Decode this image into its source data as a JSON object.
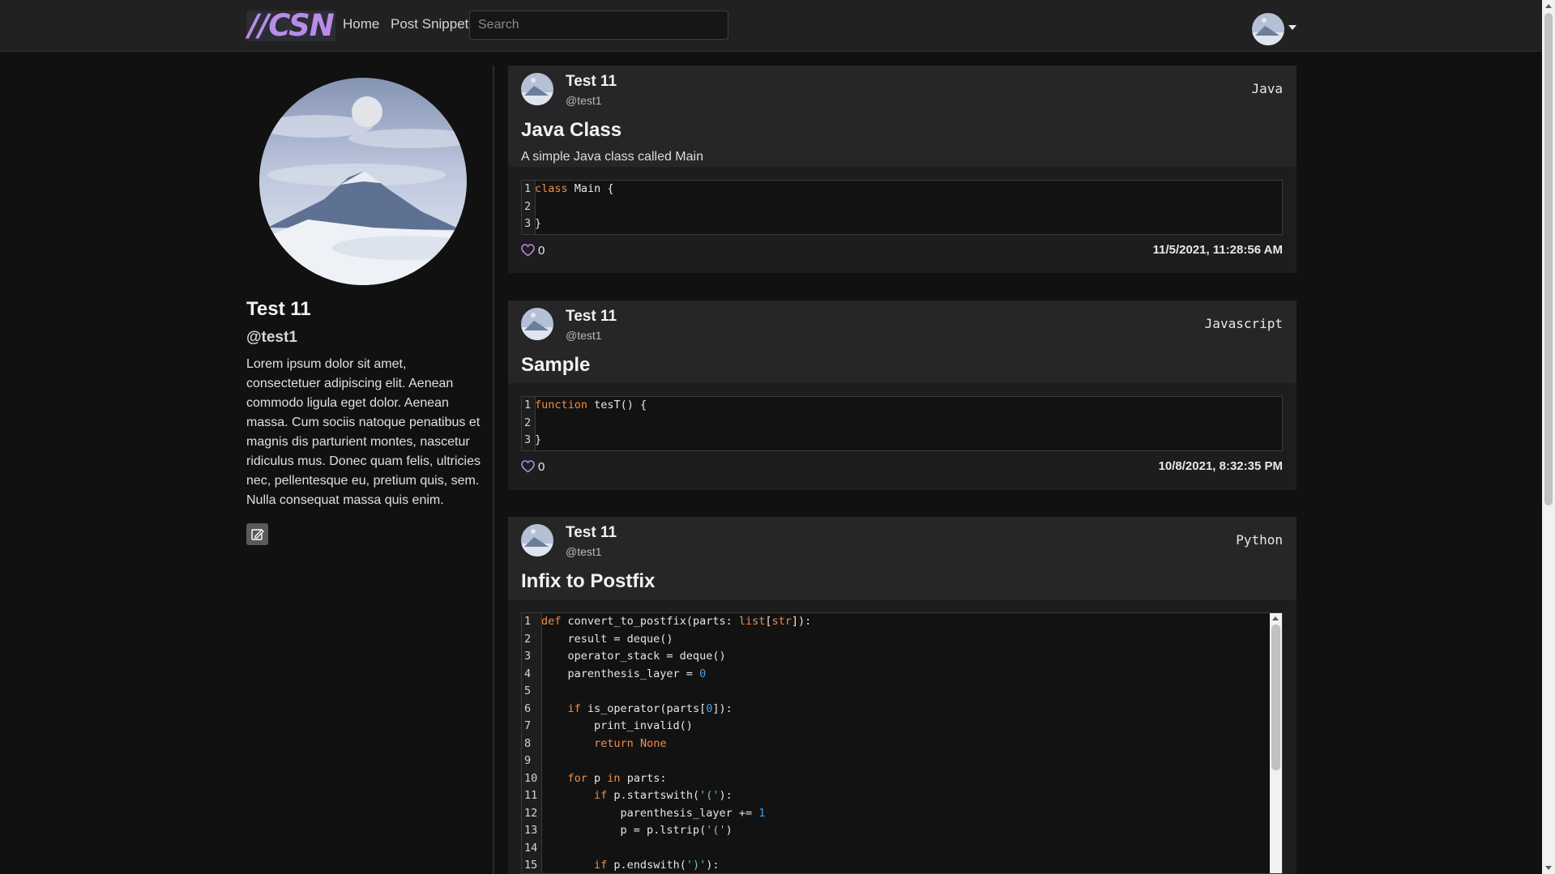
{
  "nav": {
    "logo": "//CSN",
    "home_label": "Home",
    "post_label": "Post Snippet",
    "search_placeholder": "Search"
  },
  "profile": {
    "name": "Test 11",
    "handle": "@test1",
    "bio": "Lorem ipsum dolor sit amet, consectetuer adipiscing elit. Aenean commodo ligula eget dolor. Aenean massa. Cum sociis natoque penatibus et magnis dis parturient montes, nascetur ridiculus mus. Donec quam felis, ultricies nec, pellentesque eu, pretium quis, sem. Nulla consequat massa quis enim."
  },
  "colors": {
    "background": "#111111",
    "navbar": "#212121",
    "card": "#1d1d1d",
    "card_header": "#262626",
    "logo_accent": "#b88ce8",
    "like_icon": "#b88ce8",
    "keyword": "#f08d49",
    "number": "#3fa0f0"
  },
  "icons": [
    "avatar",
    "caret-down-icon",
    "edit-icon",
    "heart-icon"
  ],
  "snippets": [
    {
      "author": "Test 11",
      "handle": "@test1",
      "language": "Java",
      "title": "Java Class",
      "description": "A simple Java class called Main",
      "line_numbers": [
        "1",
        "2",
        "3"
      ],
      "code": [
        "<span class=\"kw\">class</span> Main {",
        "",
        "}"
      ],
      "likes": "0",
      "date": "11/5/2021, 11:28:56 AM"
    },
    {
      "author": "Test 11",
      "handle": "@test1",
      "language": "Javascript",
      "title": "Sample",
      "description": "",
      "line_numbers": [
        "1",
        "2",
        "3"
      ],
      "code": [
        "<span class=\"kw\">function</span> tesT() {",
        "",
        "}"
      ],
      "likes": "0",
      "date": "10/8/2021, 8:32:35 PM"
    },
    {
      "author": "Test 11",
      "handle": "@test1",
      "language": "Python",
      "title": "Infix to Postfix",
      "description": "",
      "line_numbers": [
        "1",
        "2",
        "3",
        "4",
        "5",
        "6",
        "7",
        "8",
        "9",
        "10",
        "11",
        "12",
        "13",
        "14",
        "15"
      ],
      "code": [
        "<span class=\"kw\">def</span> convert_to_postfix(parts: <span class=\"kw\">list</span>[<span class=\"kw\">str</span>]):",
        "    result = deque()",
        "    operator_stack = deque()",
        "    parenthesis_layer = <span class=\"num\">0</span>",
        "",
        "    <span class=\"kw\">if</span> is_operator(parts[<span class=\"num\">0</span>]):",
        "        print_invalid()",
        "        <span class=\"kw\">return</span> <span class=\"kw\">None</span>",
        "",
        "    <span class=\"kw\">for</span> p <span class=\"kw\">in</span> parts:",
        "        <span class=\"kw\">if</span> p.startswith(<span class=\"str\">'('</span>):",
        "            parenthesis_layer += <span class=\"num\">1</span>",
        "            p = p.lstrip(<span class=\"str\">'('</span>)",
        "",
        "        <span class=\"kw\">if</span> p.endswith(<span class=\"str\">')'</span>):"
      ],
      "likes": "",
      "date": ""
    }
  ]
}
